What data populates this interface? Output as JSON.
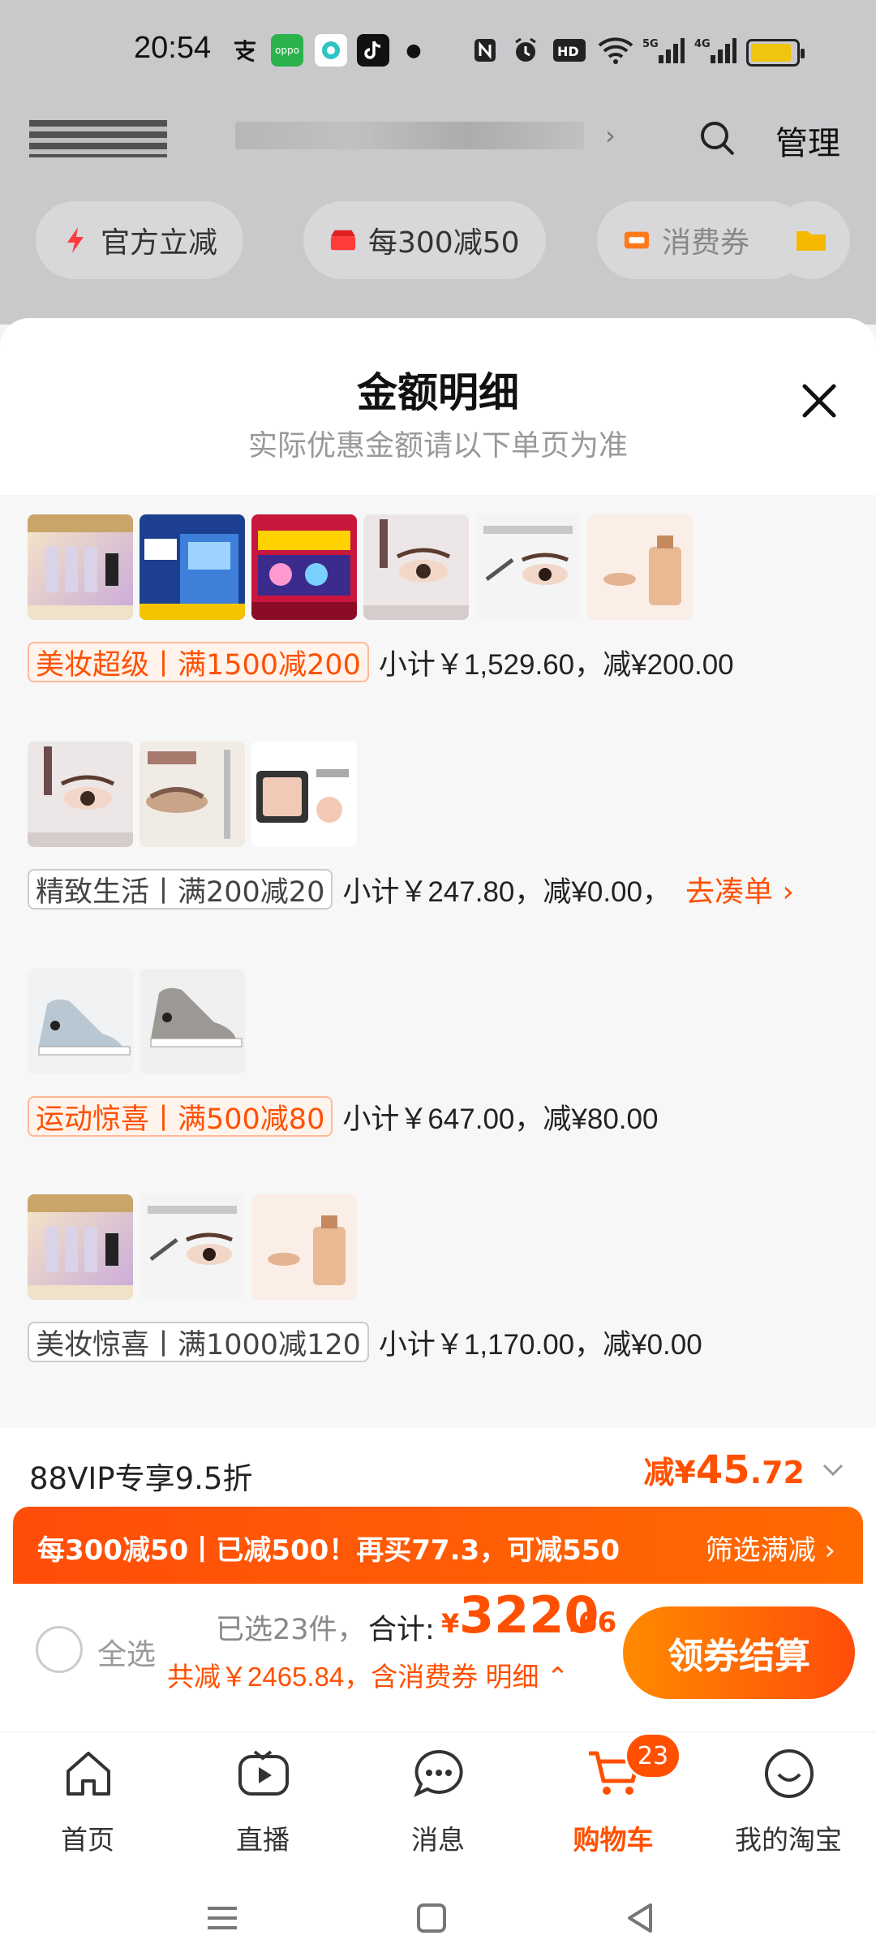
{
  "status_bar": {
    "time": "20:54"
  },
  "header": {
    "manage_label": "管理"
  },
  "filters": [
    {
      "label": "官方立减"
    },
    {
      "label": "每300减50"
    },
    {
      "label": "消费券"
    }
  ],
  "sheet": {
    "title": "金额明细",
    "subtitle": "实际优惠金额请以下单页为准"
  },
  "groups": [
    {
      "tag": "美妆超级丨满1500减200",
      "subtotal": "小计￥1,529.60，减¥200.00",
      "active": true,
      "link": ""
    },
    {
      "tag": "精致生活丨满200减20",
      "subtotal": "小计￥247.80，减¥0.00，",
      "active": false,
      "link": "去凑单"
    },
    {
      "tag": "运动惊喜丨满500减80",
      "subtotal": "小计￥647.00，减¥80.00",
      "active": true,
      "link": ""
    },
    {
      "tag": "美妆惊喜丨满1000减120",
      "subtotal": "小计￥1,170.00，减¥0.00",
      "active": false,
      "link": ""
    }
  ],
  "vip": {
    "label": "88VIP专享9.5折",
    "prefix": "减¥",
    "amount_int": "45",
    "amount_dec": ".72"
  },
  "banner": {
    "text": "每300减50丨已减500！再买77.3，可减550",
    "link": "筛选满减"
  },
  "checkout": {
    "select_all": "全选",
    "selected_count": "已选23件，",
    "total_label": "合计:",
    "currency": "¥",
    "total_int": "3220",
    "total_dec": ".66",
    "saving": "共减￥2465.84，含消费券",
    "detail_link": "明细",
    "button": "领券结算"
  },
  "tabs": [
    {
      "label": "首页"
    },
    {
      "label": "直播"
    },
    {
      "label": "消息"
    },
    {
      "label": "购物车",
      "badge": "23"
    },
    {
      "label": "我的淘宝"
    }
  ],
  "colors": {
    "accent": "#ff5000",
    "banner_start": "#ff4d0a",
    "banner_end": "#ff6a00"
  }
}
